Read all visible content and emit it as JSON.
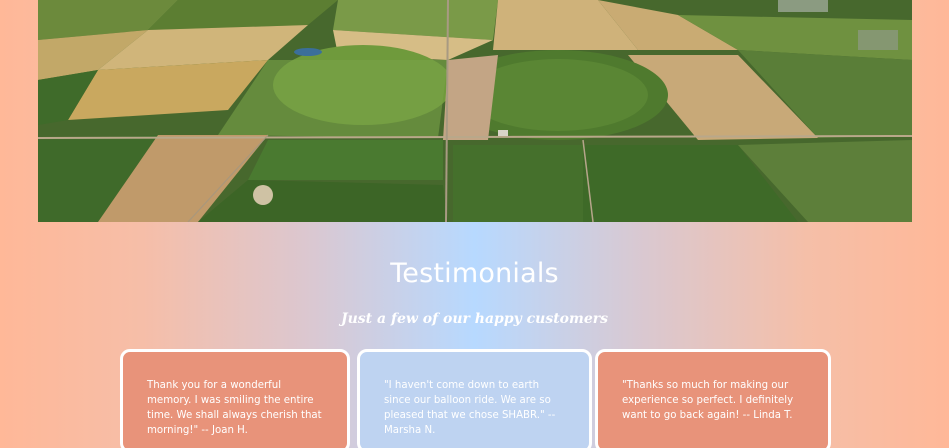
{
  "hero": {
    "image": "aerial-farmland-photo"
  },
  "testimonials": {
    "title": "Testimonials",
    "subtitle": "Just a few of our happy customers",
    "cards": [
      {
        "quote": "Thank you for a wonderful memory. I was smiling the entire time. We shall always cherish that morning!\" -- Joan H.",
        "color": "#e8937a"
      },
      {
        "quote": "\"I haven't come down to earth since our balloon ride. We are so pleased that we chose SHABR.\" -- Marsha N.",
        "color": "#bed3f1"
      },
      {
        "quote": "\"Thanks so much for making our experience so perfect. I definitely want to go back again! -- Linda T.",
        "color": "#e8937a"
      }
    ]
  },
  "colors": {
    "side_peach": "#ffb898",
    "center_blue": "#b7d9ff",
    "card_salmon": "#e8937a",
    "card_blue": "#bed3f1"
  }
}
